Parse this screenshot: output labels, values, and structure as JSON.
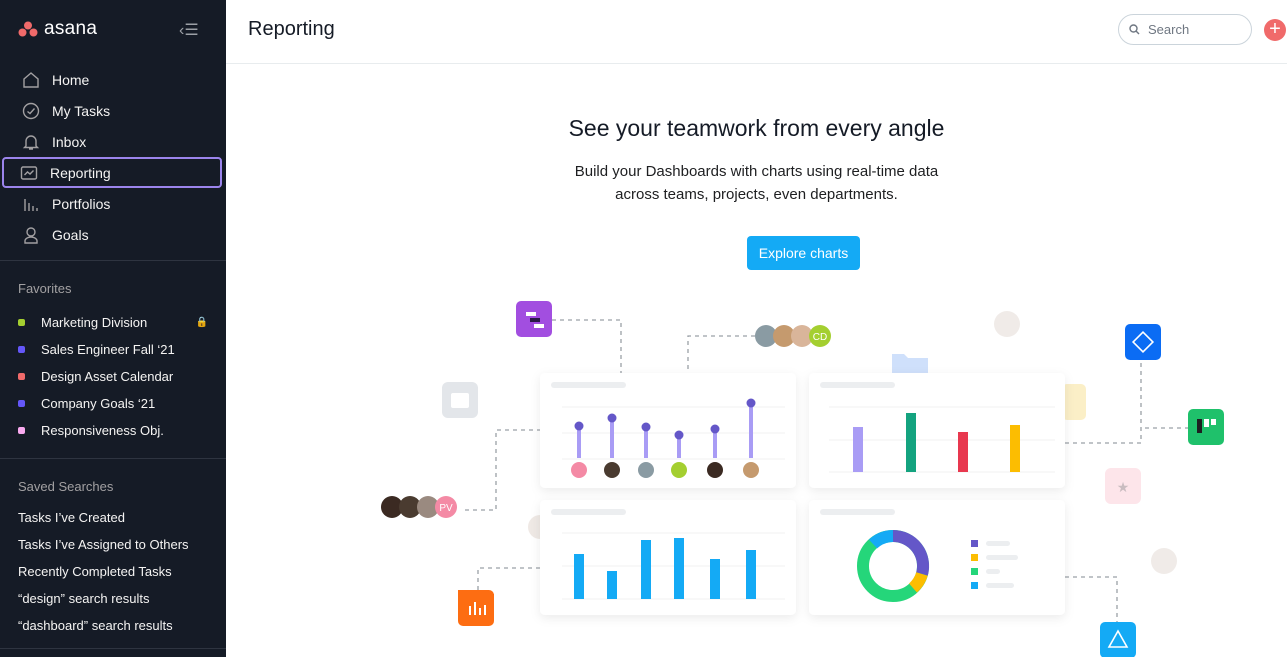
{
  "app": {
    "name": "asana"
  },
  "sidebar": {
    "nav": [
      {
        "label": "Home",
        "icon": "home-icon"
      },
      {
        "label": "My Tasks",
        "icon": "check-circle-icon"
      },
      {
        "label": "Inbox",
        "icon": "bell-icon"
      },
      {
        "label": "Reporting",
        "icon": "chart-icon",
        "active": true
      },
      {
        "label": "Portfolios",
        "icon": "bars-icon"
      },
      {
        "label": "Goals",
        "icon": "person-icon"
      }
    ],
    "favorites_title": "Favorites",
    "favorites": [
      {
        "label": "Marketing Division",
        "color": "#a4cf30",
        "locked": true
      },
      {
        "label": "Sales Engineer Fall ‘21",
        "color": "#6457f9"
      },
      {
        "label": "Design Asset Calendar",
        "color": "#f06a6a"
      },
      {
        "label": "Company Goals ‘21",
        "color": "#6457f9"
      },
      {
        "label": "Responsiveness Obj.",
        "color": "#f9aaef"
      }
    ],
    "saved_title": "Saved Searches",
    "saved": [
      "Tasks I’ve Created",
      "Tasks I’ve Assigned to Others",
      "Recently Completed Tasks",
      "“design” search results",
      "“dashboard” search results"
    ]
  },
  "header": {
    "title": "Reporting",
    "search_placeholder": "Search"
  },
  "hero": {
    "heading": "See your teamwork from every angle",
    "line1": "Build your Dashboards with charts using real-time data",
    "line2": "across teams, projects, even departments.",
    "cta": "Explore charts"
  },
  "illustration": {
    "avatar_initials": [
      "PV",
      "CD"
    ]
  },
  "colors": {
    "sidebar": "#151b26",
    "accent": "#14aaf5",
    "active_outline": "#9b84ec"
  }
}
